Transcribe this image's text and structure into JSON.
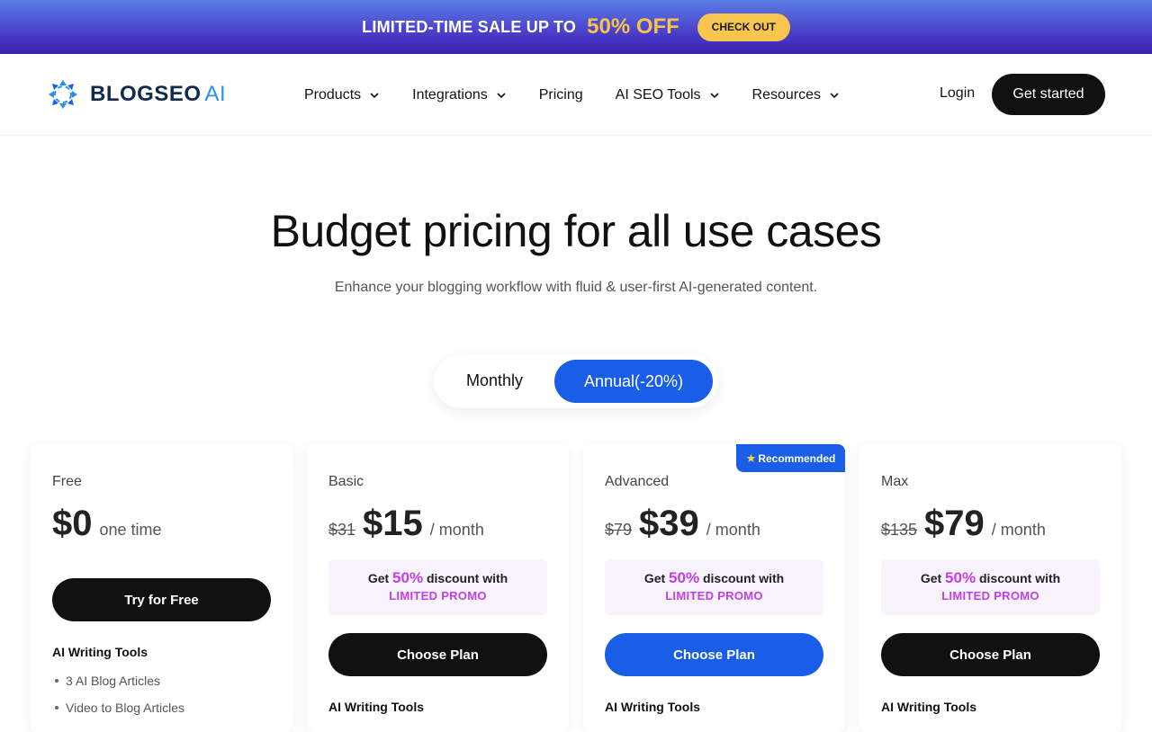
{
  "banner": {
    "text": "LIMITED-TIME SALE UP TO",
    "highlight": "50% OFF",
    "cta": "CHECK OUT"
  },
  "brand": {
    "name": "BLOGSEO",
    "suffix": "AI"
  },
  "nav": {
    "items": [
      {
        "label": "Products",
        "dropdown": true
      },
      {
        "label": "Integrations",
        "dropdown": true
      },
      {
        "label": "Pricing",
        "dropdown": false
      },
      {
        "label": "AI SEO Tools",
        "dropdown": true
      },
      {
        "label": "Resources",
        "dropdown": true
      }
    ],
    "login": "Login",
    "cta": "Get started"
  },
  "hero": {
    "title": "Budget pricing for all use cases",
    "subtitle": "Enhance your blogging workflow with fluid & user-first AI-generated content."
  },
  "billing": {
    "monthly": "Monthly",
    "annual": "Annual(-20%)",
    "selected": "annual"
  },
  "plans": [
    {
      "name": "Free",
      "old_price": "",
      "price": "$0",
      "period": "one time",
      "button": "Try for Free",
      "section": "AI Writing Tools",
      "features": [
        "3 AI Blog Articles",
        "Video to Blog Articles"
      ]
    },
    {
      "name": "Basic",
      "old_price": "$31",
      "price": "$15",
      "period": "/ month",
      "promo": {
        "get": "Get",
        "pct": "50%",
        "after": "discount with",
        "label": "LIMITED PROMO"
      },
      "button": "Choose Plan",
      "section": "AI Writing Tools"
    },
    {
      "name": "Advanced",
      "old_price": "$79",
      "price": "$39",
      "period": "/ month",
      "badge": "Recommended",
      "promo": {
        "get": "Get",
        "pct": "50%",
        "after": "discount with",
        "label": "LIMITED PROMO"
      },
      "button": "Choose Plan",
      "section": "AI Writing Tools"
    },
    {
      "name": "Max",
      "old_price": "$135",
      "price": "$79",
      "period": "/ month",
      "promo": {
        "get": "Get",
        "pct": "50%",
        "after": "discount with",
        "label": "LIMITED PROMO"
      },
      "button": "Choose Plan",
      "section": "AI Writing Tools"
    }
  ],
  "colors": {
    "accent": "#1a5ee8",
    "promo": "#c23ee6",
    "banner_highlight": "#f7c24b",
    "dark": "#111111"
  },
  "icons": {
    "logo": "logo-arrows-icon",
    "dropdown": "chevron-down-icon",
    "badge": "star-icon"
  }
}
